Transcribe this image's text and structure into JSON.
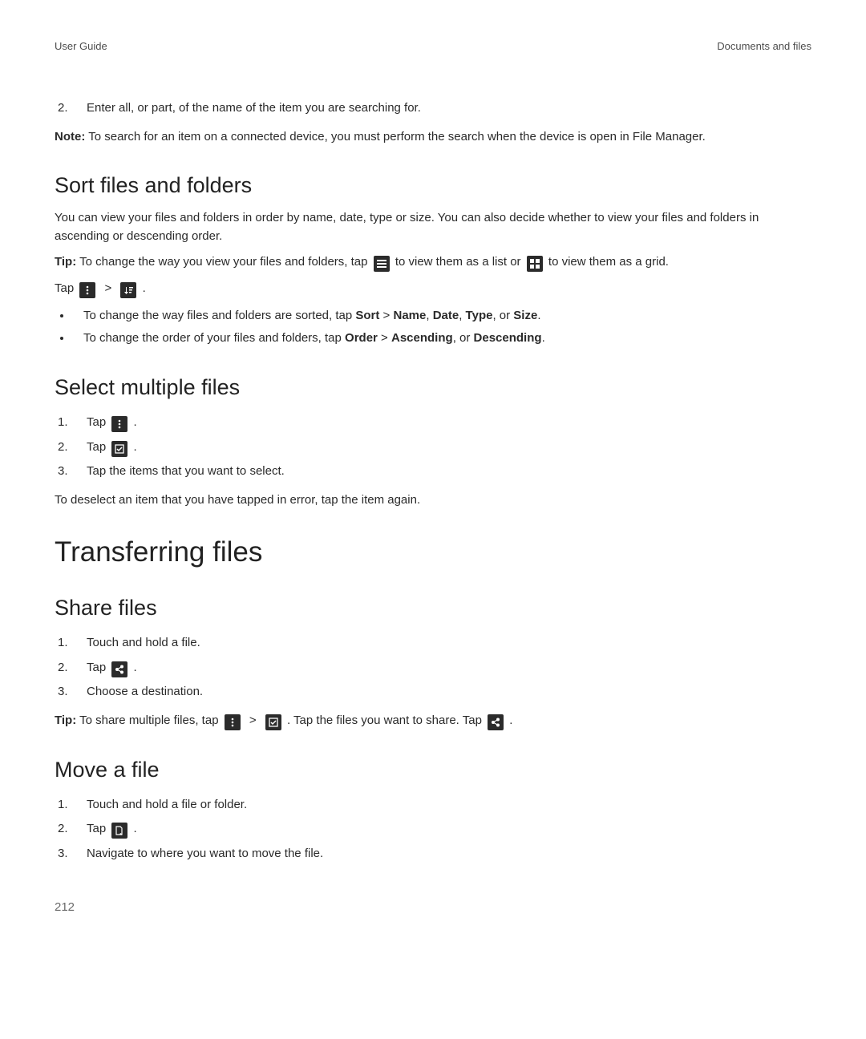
{
  "header": {
    "left": "User Guide",
    "right": "Documents and files"
  },
  "intro_step": {
    "num": "2.",
    "text": "Enter all, or part, of the name of the item you are searching for."
  },
  "note": {
    "label": "Note:",
    "text": " To search for an item on a connected device, you must perform the search when the device is open in File Manager."
  },
  "sort": {
    "heading": "Sort files and folders",
    "desc": "You can view your files and folders in order by name, date, type or size. You can also decide whether to view your files and folders in ascending or descending order.",
    "tip": {
      "label": "Tip:",
      "pre": " To change the way you view your files and folders, tap ",
      "mid": " to view them as a list or ",
      "post": " to view them as a grid."
    },
    "tapline": {
      "pre": "Tap ",
      "sep": " > ",
      "post": " ."
    },
    "bullets": {
      "b1": {
        "pre": "To change the way files and folders are sorted, tap ",
        "sort": "Sort",
        "gt": " > ",
        "name": "Name",
        "c1": ", ",
        "date": "Date",
        "c2": ", ",
        "type": "Type",
        "c3": ", or ",
        "size": "Size",
        "end": "."
      },
      "b2": {
        "pre": "To change the order of your files and folders, tap ",
        "order": "Order",
        "gt": " > ",
        "asc": "Ascending",
        "c1": ", or ",
        "desc": "Descending",
        "end": "."
      }
    }
  },
  "select": {
    "heading": "Select multiple files",
    "steps": {
      "s1": "Tap ",
      "s2": "Tap ",
      "s3": "Tap the items that you want to select."
    },
    "dot": " .",
    "deselect": "To deselect an item that you have tapped in error, tap the item again."
  },
  "transfer": {
    "heading": "Transferring files"
  },
  "share": {
    "heading": "Share files",
    "steps": {
      "s1": "Touch and hold a file.",
      "s2": "Tap ",
      "s3": "Choose a destination."
    },
    "dot": " .",
    "tip": {
      "label": "Tip:",
      "pre": " To share multiple files, tap ",
      "sep": " > ",
      "mid": " . Tap the files you want to share. Tap ",
      "post": " ."
    }
  },
  "move": {
    "heading": "Move a file",
    "steps": {
      "s1": "Touch and hold a file or folder.",
      "s2": "Tap ",
      "s3": "Navigate to where you want to move the file."
    },
    "dot": " ."
  },
  "pagenum": "212"
}
